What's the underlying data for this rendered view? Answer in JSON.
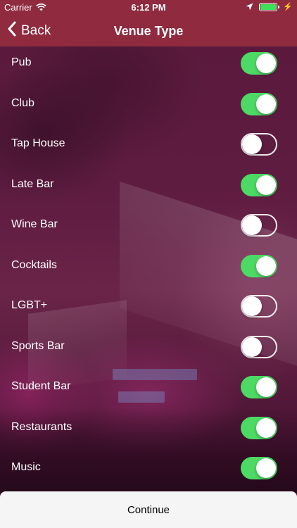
{
  "status_bar": {
    "carrier": "Carrier",
    "time": "6:12 PM",
    "battery_color": "#3ee05a"
  },
  "nav": {
    "back_label": "Back",
    "title": "Venue Type"
  },
  "colors": {
    "header": "#8f2a3f",
    "toggle_on": "#4cd964"
  },
  "venue_types": [
    {
      "label": "Pub",
      "on": true
    },
    {
      "label": "Club",
      "on": true
    },
    {
      "label": "Tap House",
      "on": false
    },
    {
      "label": "Late Bar",
      "on": true
    },
    {
      "label": "Wine Bar",
      "on": false
    },
    {
      "label": "Cocktails",
      "on": true
    },
    {
      "label": "LGBT+",
      "on": false
    },
    {
      "label": "Sports Bar",
      "on": false
    },
    {
      "label": "Student Bar",
      "on": true
    },
    {
      "label": "Restaurants",
      "on": true
    },
    {
      "label": "Music",
      "on": true
    }
  ],
  "continue_label": "Continue",
  "icons": {
    "wifi": "wifi-icon",
    "location": "location-arrow-icon",
    "battery": "battery-icon",
    "charging": "charging-bolt-icon",
    "back": "chevron-left-icon"
  }
}
